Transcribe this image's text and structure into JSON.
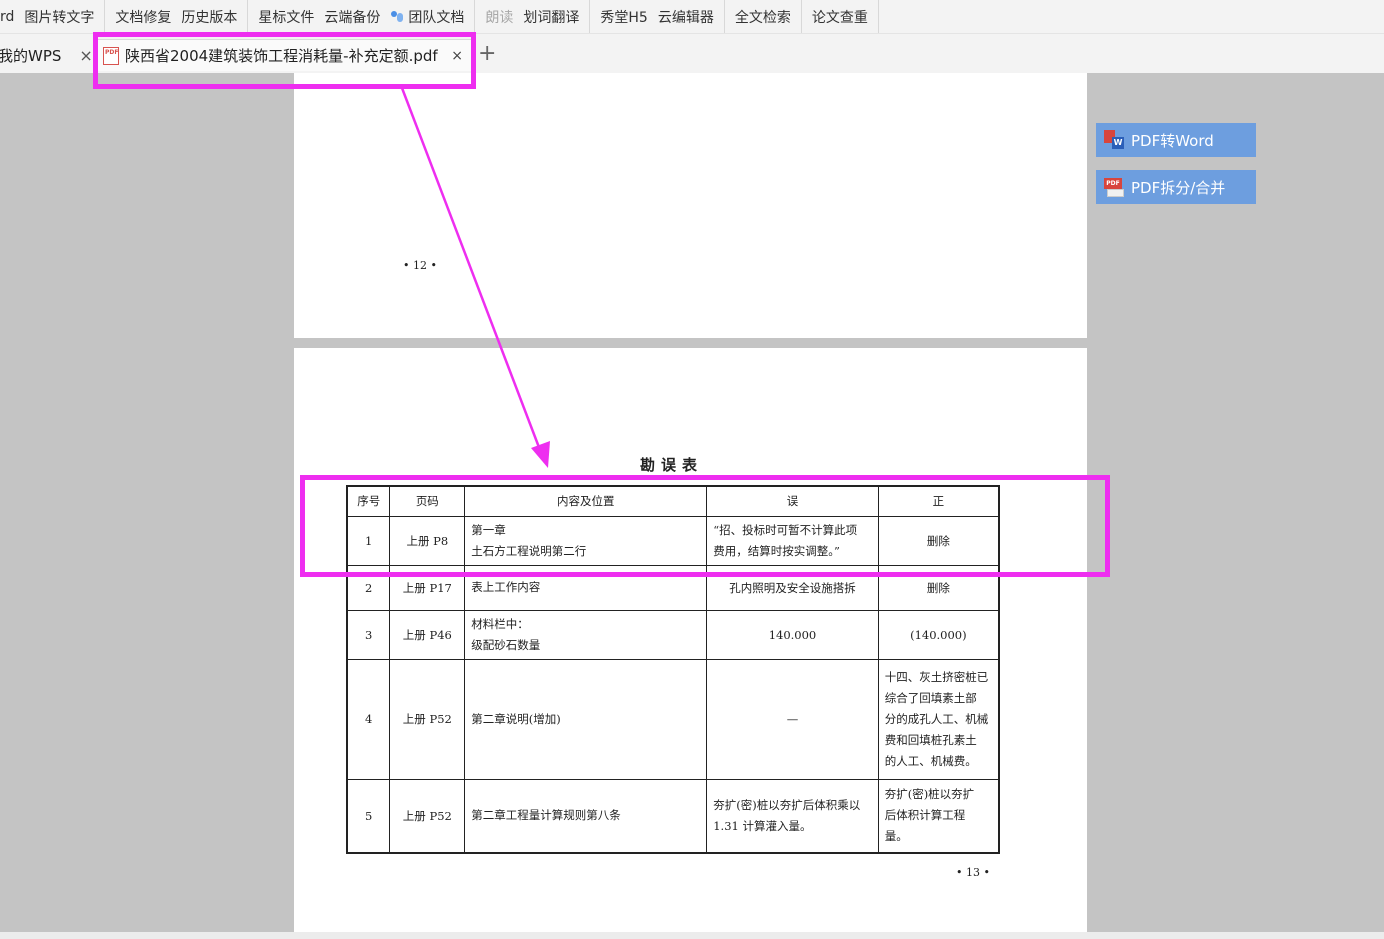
{
  "toolbar": {
    "groups": [
      [
        "rd",
        "图片转文字"
      ],
      [
        "文档修复",
        "历史版本"
      ],
      [
        "星标文件",
        "云端备份",
        "团队文档"
      ],
      [
        "朗读",
        "划词翻译"
      ],
      [
        "秀堂H5",
        "云编辑器"
      ],
      [
        "全文检索"
      ],
      [
        "论文查重"
      ]
    ]
  },
  "tabs": {
    "mywps_label": "我的WPS",
    "pdf_label": "陕西省2004建筑装饰工程消耗量-补充定额.pdf",
    "close_glyph": "×",
    "add_glyph": "+"
  },
  "document": {
    "page12_number": "• 12 •",
    "page13_number": "• 13 •",
    "errata": {
      "title": "勘误表",
      "headers": [
        "序号",
        "页码",
        "内容及位置",
        "误",
        "正"
      ],
      "rows": [
        {
          "no": "1",
          "page": "上册 P8",
          "content": [
            "第一章",
            "土石方工程说明第二行"
          ],
          "wrong": [
            "“招、投标时可暂不计算此项",
            "费用，结算时按实调整。”"
          ],
          "right": [
            "删除"
          ]
        },
        {
          "no": "2",
          "page": "上册 P17",
          "content": [
            "表上工作内容"
          ],
          "wrong": [
            "孔内照明及安全设施搭拆"
          ],
          "right": [
            "删除"
          ]
        },
        {
          "no": "3",
          "page": "上册 P46",
          "content": [
            "材料栏中：",
            "级配砂石数量"
          ],
          "wrong": [
            "140.000"
          ],
          "right": [
            "(140.000)"
          ]
        },
        {
          "no": "4",
          "page": "上册 P52",
          "content": [
            "第二章说明(增加)"
          ],
          "wrong": [
            "—"
          ],
          "right": [
            "十四、灰土挤密桩已",
            "综合了回填素土部",
            "分的成孔人工、机械",
            "费和回填桩孔素土",
            "的人工、机械费。"
          ]
        },
        {
          "no": "5",
          "page": "上册 P52",
          "content": [
            "第二章工程量计算规则第八条"
          ],
          "wrong": [
            "夯扩(密)桩以夯扩后体积乘以",
            "1.31 计算灌入量。"
          ],
          "right": [
            "夯扩(密)桩以夯扩",
            "后体积计算工程",
            "量。"
          ]
        }
      ]
    }
  },
  "side_buttons": {
    "pdf_to_word": "PDF转Word",
    "pdf_split_merge": "PDF拆分/合并"
  },
  "colors": {
    "annotation": "#ee2ef0",
    "side_button": "#6d9edf",
    "workspace": "#c4c4c4"
  }
}
